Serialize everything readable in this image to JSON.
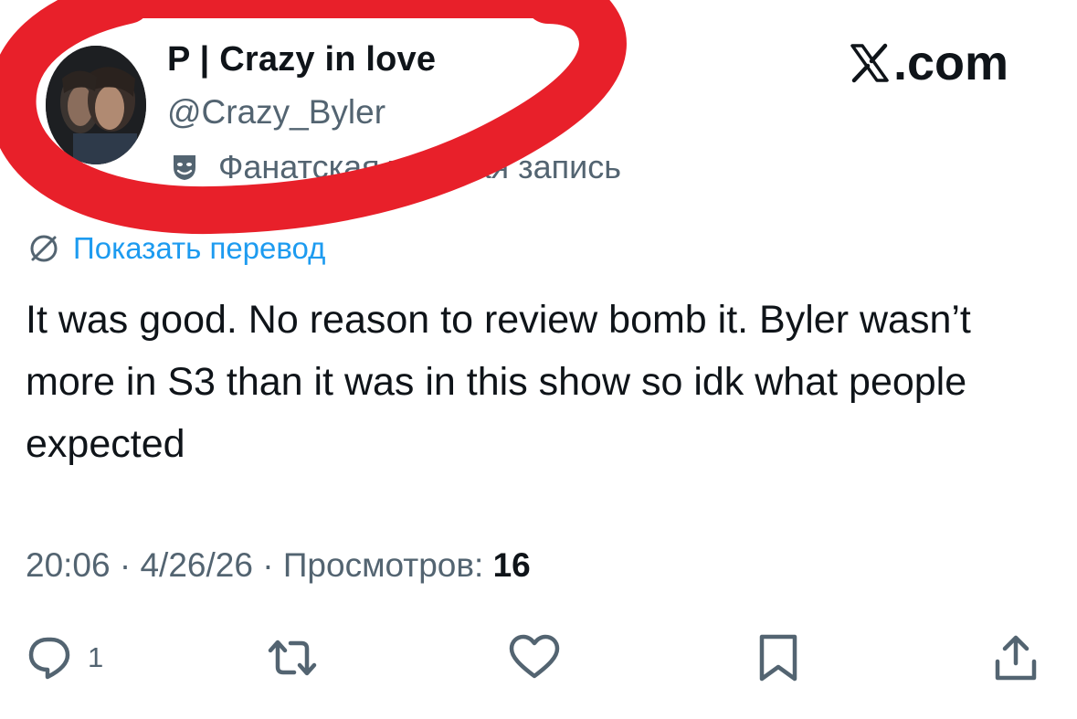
{
  "tweet": {
    "display_name": "P | Crazy in love",
    "handle": "@Crazy_Byler",
    "account_label": "Фанатская учетная запись",
    "site_logo": ".com",
    "translate_label": "Показать перевод",
    "text": "It was good. No reason to review bomb it. Byler wasn’t more in S3 than it was in this show so idk what people expected",
    "time": "20:06",
    "date": "4/26/26",
    "views_label": "Просмотров:",
    "views_count": "16",
    "separator": "·"
  },
  "actions": {
    "reply_count": "1"
  },
  "icons": {
    "avatar": "profile-photo",
    "account_label": "theater-mask-icon",
    "translate": "globe-icon",
    "reply": "speech-bubble-icon",
    "retweet": "retweet-arrows-icon",
    "like": "heart-icon",
    "bookmark": "bookmark-icon",
    "share": "share-upload-icon"
  },
  "colors": {
    "text": "#0f1419",
    "secondary": "#536471",
    "link": "#1d9bf0",
    "annotation": "#e8202a"
  }
}
